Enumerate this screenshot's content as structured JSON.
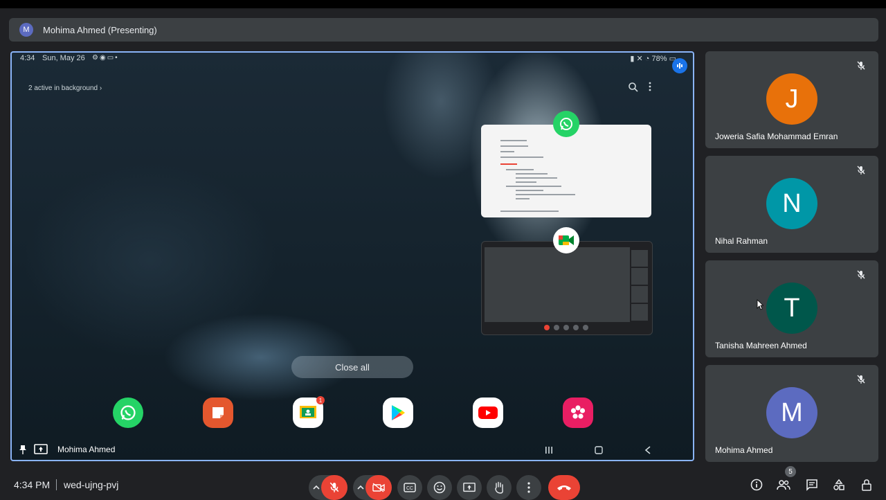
{
  "banner": {
    "avatar_letter": "M",
    "text": "Mohima Ahmed (Presenting)"
  },
  "shared_screen": {
    "status_time": "4:34",
    "status_date": "Sun, May 26",
    "battery": "78%",
    "background_apps": "2 active in background ›",
    "close_all": "Close all",
    "presenter_name": "Mohima Ahmed",
    "recent_apps": [
      "WhatsApp",
      "Google Meet"
    ],
    "dock_apps": [
      "WhatsApp",
      "Notes",
      "Google Classroom",
      "Play Store",
      "YouTube",
      "Gallery"
    ],
    "classroom_badge": "1"
  },
  "participants": [
    {
      "letter": "J",
      "name": "Joweria Safia Mohammad Emran",
      "color": "#e8710a"
    },
    {
      "letter": "N",
      "name": "Nihal Rahman",
      "color": "#0097a7"
    },
    {
      "letter": "T",
      "name": "Tanisha Mahreen Ahmed",
      "color": "#00574b"
    },
    {
      "letter": "M",
      "name": "Mohima Ahmed",
      "color": "#5c6bc0"
    }
  ],
  "bottom_bar": {
    "time": "4:34 PM",
    "meeting_code": "wed-ujng-pvj",
    "participant_count": "5"
  },
  "colors": {
    "accent": "#8ab4f8",
    "end_call": "#ea4335",
    "tile_bg": "#3c4043"
  }
}
